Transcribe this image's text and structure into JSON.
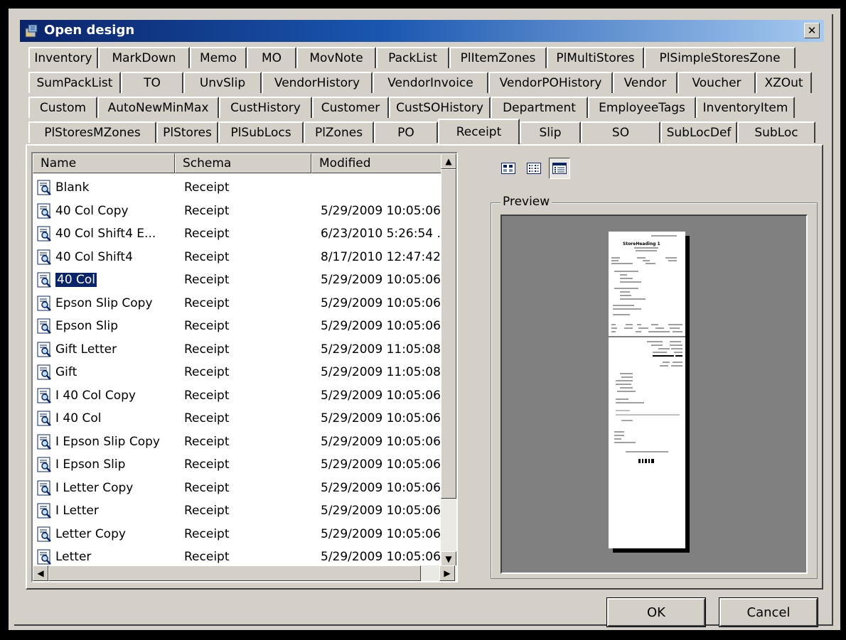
{
  "window": {
    "title": "Open design"
  },
  "tabs": {
    "row1": [
      "Inventory",
      "MarkDown",
      "Memo",
      "MO",
      "MovNote",
      "PackList",
      "PlItemZones",
      "PlMultiStores",
      "PlSimpleStoresZone"
    ],
    "row2": [
      "SumPackList",
      "TO",
      "UnvSlip",
      "VendorHistory",
      "VendorInvoice",
      "VendorPOHistory",
      "Vendor",
      "Voucher",
      "XZOut"
    ],
    "row3": [
      "Custom",
      "AutoNewMinMax",
      "CustHistory",
      "Customer",
      "CustSOHistory",
      "Department",
      "EmployeeTags",
      "InventoryItem"
    ],
    "row4": [
      "PlStoresMZones",
      "PlStores",
      "PlSubLocs",
      "PlZones",
      "PO",
      "Receipt",
      "Slip",
      "SO",
      "SubLocDef",
      "SubLoc"
    ],
    "active": "Receipt"
  },
  "list": {
    "columns": [
      "Name",
      "Schema",
      "Modified"
    ],
    "rows": [
      {
        "name": "Blank",
        "schema": "Receipt",
        "modified": ""
      },
      {
        "name": "40 Col Copy",
        "schema": "Receipt",
        "modified": "5/29/2009 10:05:06."
      },
      {
        "name": "40 Col Shift4 E...",
        "schema": "Receipt",
        "modified": "6/23/2010 5:26:54 .."
      },
      {
        "name": "40 Col Shift4",
        "schema": "Receipt",
        "modified": "8/17/2010 12:47:42."
      },
      {
        "name": "40 Col",
        "schema": "Receipt",
        "modified": "5/29/2009 10:05:06.",
        "selected": true
      },
      {
        "name": "Epson Slip Copy",
        "schema": "Receipt",
        "modified": "5/29/2009 10:05:06."
      },
      {
        "name": "Epson Slip",
        "schema": "Receipt",
        "modified": "5/29/2009 10:05:06."
      },
      {
        "name": "Gift Letter",
        "schema": "Receipt",
        "modified": "5/29/2009 11:05:08."
      },
      {
        "name": "Gift",
        "schema": "Receipt",
        "modified": "5/29/2009 11:05:08."
      },
      {
        "name": "I 40 Col Copy",
        "schema": "Receipt",
        "modified": "5/29/2009 10:05:06."
      },
      {
        "name": "I 40 Col",
        "schema": "Receipt",
        "modified": "5/29/2009 10:05:06."
      },
      {
        "name": "I Epson Slip Copy",
        "schema": "Receipt",
        "modified": "5/29/2009 10:05:06."
      },
      {
        "name": "I Epson Slip",
        "schema": "Receipt",
        "modified": "5/29/2009 10:05:06."
      },
      {
        "name": "I Letter Copy",
        "schema": "Receipt",
        "modified": "5/29/2009 10:05:06."
      },
      {
        "name": "I Letter",
        "schema": "Receipt",
        "modified": "5/29/2009 10:05:06."
      },
      {
        "name": "Letter Copy",
        "schema": "Receipt",
        "modified": "5/29/2009 10:05:06."
      },
      {
        "name": "Letter",
        "schema": "Receipt",
        "modified": "5/29/2009 10:05:06."
      }
    ]
  },
  "view_buttons": [
    {
      "icon": "large-icons-view-icon",
      "pressed": false
    },
    {
      "icon": "list-view-icon",
      "pressed": false
    },
    {
      "icon": "details-view-icon",
      "pressed": true
    }
  ],
  "preview": {
    "label": "Preview",
    "receipt_heading": "StoreHeading 1"
  },
  "buttons": {
    "ok": "OK",
    "cancel": "Cancel"
  },
  "colors": {
    "title_start": "#0a246a",
    "title_end": "#a6caf0",
    "face": "#d4d0c8",
    "selection": "#0a246a",
    "preview_bg": "#808080"
  }
}
